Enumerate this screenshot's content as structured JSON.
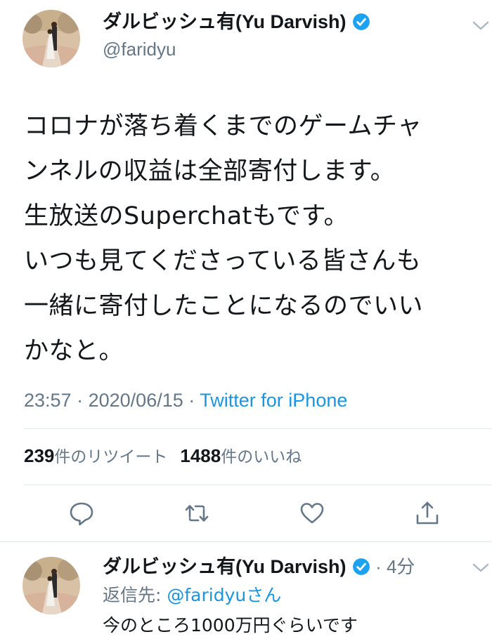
{
  "tweet": {
    "author": {
      "display_name": "ダルビッシュ有(Yu Darvish)",
      "handle": "@faridyu",
      "verified": true
    },
    "text_lines": [
      "コロナが落ち着くまでのゲームチャ",
      "ンネルの収益は全部寄付します。",
      "生放送のSuperchatもです。",
      "いつも見てくださっている皆さんも",
      "一緒に寄付したことになるのでいい",
      "かなと。"
    ],
    "time": "23:57",
    "date": "2020/06/15",
    "separator": "·",
    "source": "Twitter for iPhone",
    "retweet_count": "239",
    "retweet_label": "件のリツイート",
    "like_count": "1488",
    "like_label": "件のいいね"
  },
  "actions": [
    {
      "name": "reply",
      "icon": "reply-icon"
    },
    {
      "name": "retweet",
      "icon": "retweet-icon"
    },
    {
      "name": "like",
      "icon": "heart-icon"
    },
    {
      "name": "share",
      "icon": "share-icon"
    }
  ],
  "reply": {
    "display_name": "ダルビッシュ有(Yu Darvish)",
    "time_ago": "· 4分",
    "reply_to_prefix": "返信先: ",
    "reply_to_mention": "@faridyuさん",
    "text": "今のところ1000万円ぐらいです"
  },
  "colors": {
    "text": "#14171a",
    "secondary": "#657786",
    "link": "#1b95e0",
    "divider": "#e1e8ed",
    "verified": "#1da1f2"
  }
}
